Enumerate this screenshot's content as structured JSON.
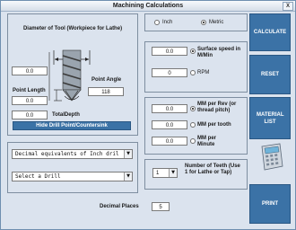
{
  "window": {
    "title": "Machining Calculations",
    "close_glyph": "X"
  },
  "tool": {
    "diameter_label": "Diameter of Tool (Workpiece for Lathe)",
    "diameter_value": "0.0",
    "point_angle_label": "Point Angle",
    "point_angle_value": "118",
    "point_length_label": "Point Length",
    "point_length_value": "0.0",
    "total_depth_label": "TotalDepth",
    "total_depth_value": "0.0",
    "hide_button": "Hide Drill Point/Countersink"
  },
  "units": {
    "inch_label": "Inch",
    "metric_label": "Metric",
    "selected": "Metric"
  },
  "speed": {
    "surface_speed_label": "Surface speed in M/Min",
    "surface_speed_value": "0.0",
    "rpm_label": "RPM",
    "rpm_value": "0"
  },
  "feed": {
    "mm_per_rev_label": "MM per Rev (or thread pitch)",
    "mm_per_rev_value": "0.0",
    "mm_per_tooth_label": "MM per tooth",
    "mm_per_tooth_value": "0.0",
    "mm_per_minute_label": "MM per Minute",
    "mm_per_minute_value": "0.0"
  },
  "selects": {
    "equivalents_value": "Decimal equivalents of Inch dril",
    "drill_value": "Select a Drill"
  },
  "teeth": {
    "value": "1",
    "label": "Number of Teeth (Use 1 for Lathe or Tap)"
  },
  "decimal": {
    "label": "Decimal Places",
    "value": "5"
  },
  "buttons": {
    "calculate": "CALCULATE",
    "reset": "RESET",
    "material_list": "MATERIAL LIST",
    "print": "PRINT"
  },
  "colors": {
    "button_blue": "#3b72a6",
    "panel_bg": "#dbe3ee"
  }
}
